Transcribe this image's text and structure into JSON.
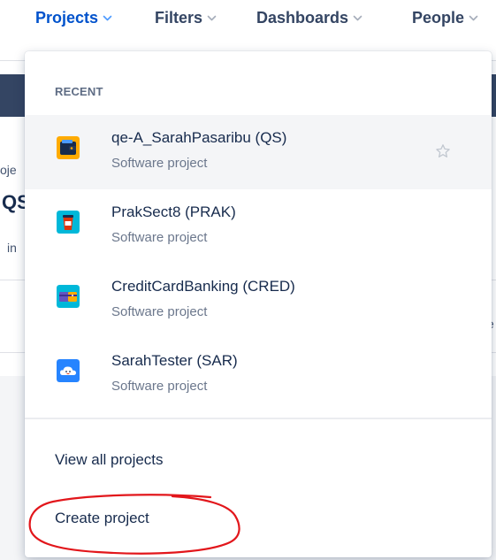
{
  "nav": {
    "items": [
      {
        "label": "Projects",
        "active": true
      },
      {
        "label": "Filters",
        "active": false
      },
      {
        "label": "Dashboards",
        "active": false
      },
      {
        "label": "People",
        "active": false
      }
    ],
    "active_color": "#0052cc",
    "inactive_color": "#344563"
  },
  "background": {
    "fragment_a": "oje",
    "fragment_b": "QS",
    "fragment_c": "in",
    "fragment_d": "e"
  },
  "dropdown": {
    "section_heading": "RECENT",
    "projects": [
      {
        "name": "qe-A_SarahPasaribu (QS)",
        "type": "Software project",
        "avatar": "wallet-avatar-icon",
        "hovered": true
      },
      {
        "name": "PrakSect8 (PRAK)",
        "type": "Software project",
        "avatar": "coffee-cup-avatar-icon",
        "hovered": false
      },
      {
        "name": "CreditCardBanking (CRED)",
        "type": "Software project",
        "avatar": "credit-card-avatar-icon",
        "hovered": false
      },
      {
        "name": "SarahTester (SAR)",
        "type": "Software project",
        "avatar": "cloud-avatar-icon",
        "hovered": false
      }
    ],
    "view_all_label": "View all projects",
    "create_label": "Create project",
    "annotation_color": "#e2161b"
  }
}
